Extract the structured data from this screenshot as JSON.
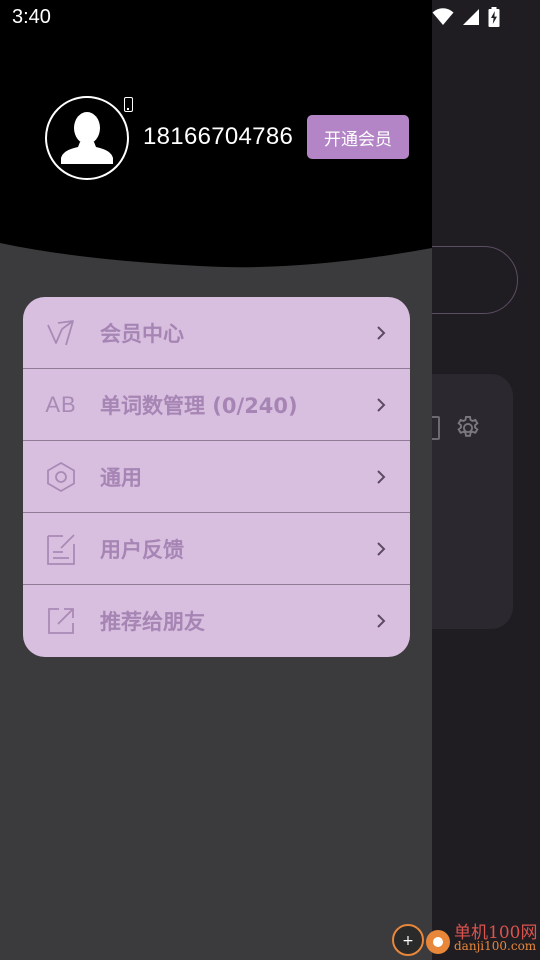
{
  "status_bar": {
    "time": "3:40",
    "icons": [
      "wifi-icon",
      "signal-icon",
      "battery-charging-icon"
    ]
  },
  "drawer": {
    "header": {
      "phone_number": "18166704786",
      "vip_button_label": "开通会员",
      "avatar_icon": "person-silhouette-icon",
      "device_icon": "phone-icon"
    },
    "menu": [
      {
        "label": "会员中心",
        "icon": "vip-icon"
      },
      {
        "label": "单词数管理 (0/240)",
        "icon": "ab-icon",
        "icon_text": "AB"
      },
      {
        "label": "通用",
        "icon": "hexagon-settings-icon"
      },
      {
        "label": "用户反馈",
        "icon": "feedback-icon"
      },
      {
        "label": "推荐给朋友",
        "icon": "share-icon"
      }
    ]
  },
  "watermark": {
    "title": "单机100网",
    "url": "danji100.com"
  },
  "colors": {
    "drawer_bg": "#3b3a3d",
    "menu_card_bg": "#d8bfdf",
    "menu_text": "#a685b4",
    "vip_button_bg": "#b385c6",
    "header_bg": "#000000"
  }
}
